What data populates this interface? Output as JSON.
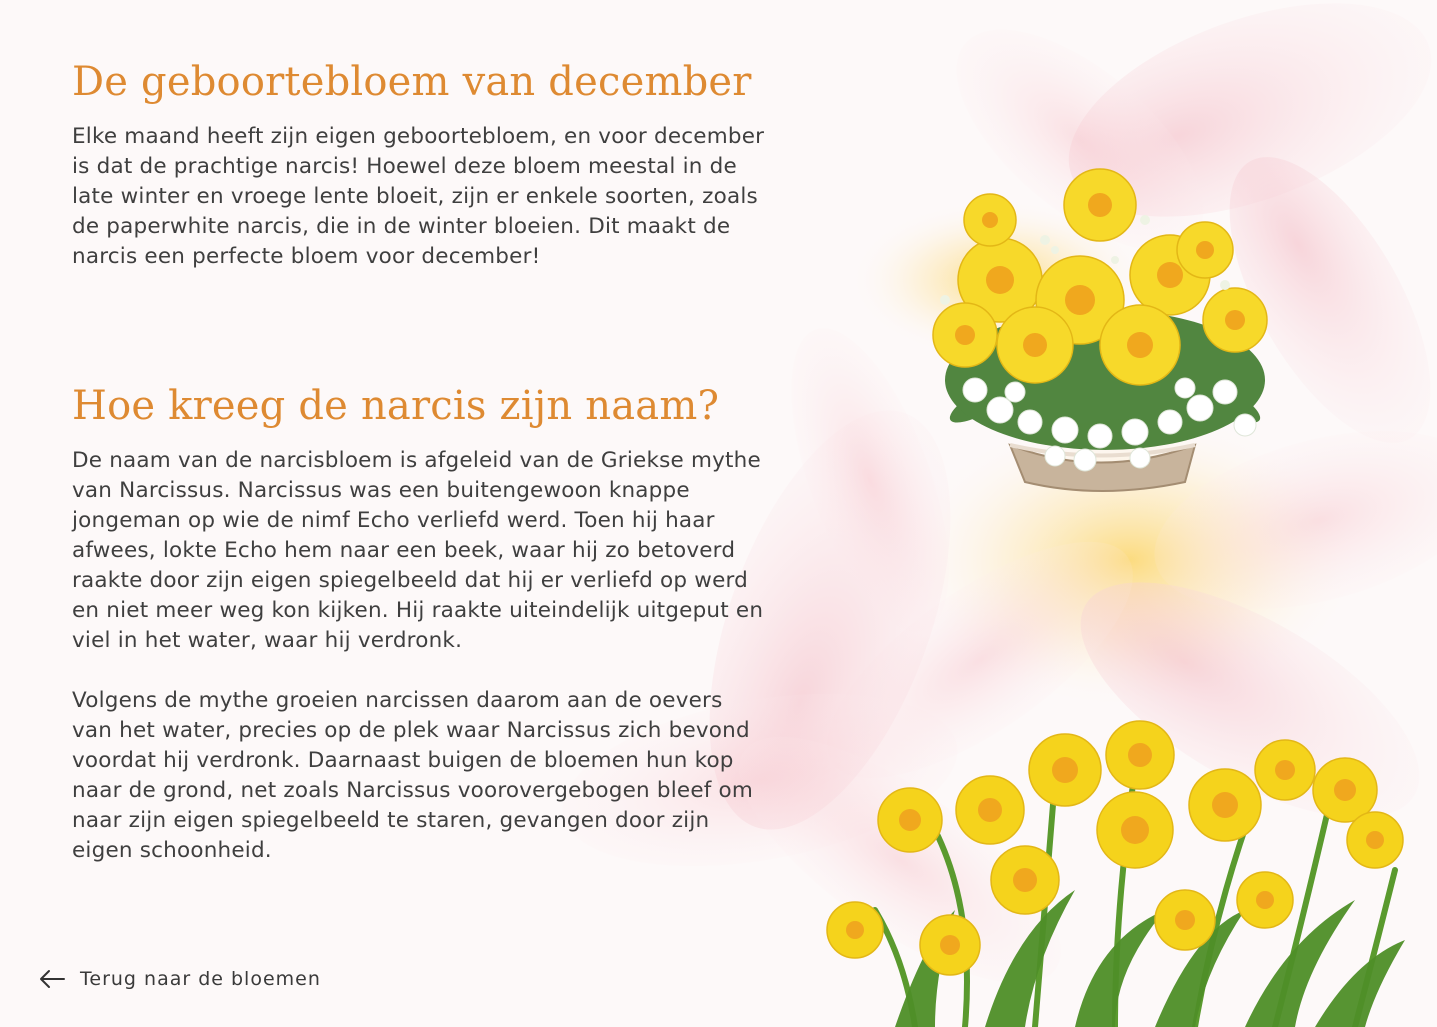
{
  "sections": [
    {
      "title": "De geboortebloem van december",
      "paragraphs": [
        "Elke maand heeft zijn eigen geboortebloem, en voor december\nis dat de prachtige narcis! Hoewel deze bloem meestal in de\nlate winter en vroege lente bloeit, zijn er enkele soorten, zoals\nde paperwhite narcis, die in de winter bloeien. Dit maakt de\nnarcis een perfecte bloem voor december!"
      ]
    },
    {
      "title": "Hoe kreeg de narcis zijn naam?",
      "paragraphs": [
        "De naam van de narcisbloem is afgeleid van de Griekse mythe\nvan Narcissus. Narcissus was een buitengewoon knappe\njongeman op wie de nimf Echo verliefd werd. Toen hij haar\nafwees, lokte Echo hem naar een beek, waar hij zo betoverd\nraakte door zijn eigen spiegelbeeld dat hij er verliefd op werd\nen niet meer weg kon kijken. Hij raakte uiteindelijk uitgeput en\nviel in het water, waar hij verdronk.",
        "Volgens de mythe groeien narcissen daarom aan de oevers\nvan het water, precies op de plek waar Narcissus zich bevond\nvoordat hij verdronk. Daarnaast buigen de bloemen hun kop\nnaar de grond, net zoals Narcissus voorovergebogen bleef om\nnaar zijn eigen spiegelbeeld te staren, gevangen door zijn\neigen schoonheid."
      ]
    }
  ],
  "back_link": {
    "label": "Terug naar de bloemen",
    "icon": "arrow-left-icon"
  },
  "colors": {
    "heading": "#de8a32",
    "text": "#3f3f3f",
    "background": "#fdf9f9",
    "lily_pink": "#f6c9cf",
    "daffodil_yellow": "#f5d31c",
    "daffodil_orange": "#f0a81e"
  }
}
